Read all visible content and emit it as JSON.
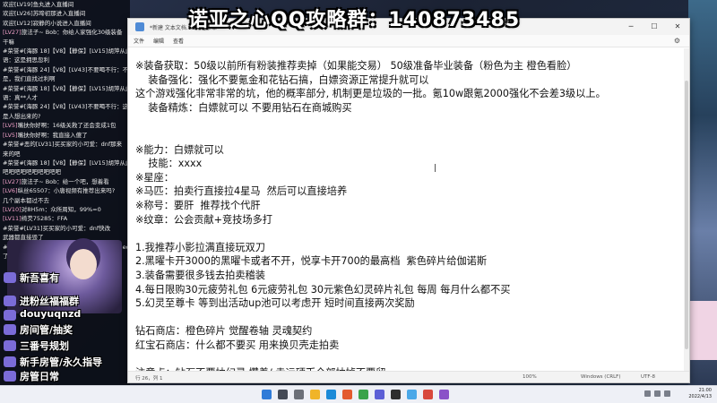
{
  "banner": "诺亚之心QQ攻略群：140873485",
  "chat": {
    "lines": [
      {
        "level": "",
        "text": "欢迎[LV19]鱼丸进入直播间"
      },
      {
        "level": "",
        "text": "欢迎[LV26]苏啼初那进入直播间"
      },
      {
        "level": "",
        "text": "欢迎[LV12]寂静的小说进入直播间"
      },
      {
        "level": "",
        "text": ""
      },
      {
        "level": "[LV27]",
        "text": "旅法子~ Bob：你给人家强化30级装备"
      },
      {
        "level": "",
        "text": "干嘛"
      },
      {
        "level": "",
        "text": "#荣誉#[海豚 18]【V8】【静保】[LV15]胡萍从此日"
      },
      {
        "level": "",
        "text": "语：这是拥思忽利"
      },
      {
        "level": "",
        "text": "#荣誉#[海豚 24]【V8】[LV43]不要喝不行：不"
      },
      {
        "level": "",
        "text": "是，我们直找过利啊"
      },
      {
        "level": "",
        "text": "#荣誉#[海豚 18]【V8】【静保】[LV15]胡萍从此日"
      },
      {
        "level": "",
        "text": "语：真**人才"
      },
      {
        "level": "",
        "text": "#荣誉#[海豚 24]【V8】[LV43]不要喝不行：这"
      },
      {
        "level": "",
        "text": "是人想出来的?"
      },
      {
        "level": "[LV5]",
        "text": "嘴扶你好啊：16级关救了还会变成1包"
      },
      {
        "level": "[LV5]",
        "text": "嘴扶你好啊：我直接入傻了"
      },
      {
        "level": "",
        "text": "#荣誉#恶的[LV31]买买家的小可爱：dnf那来"
      },
      {
        "level": "",
        "text": "来的吧"
      },
      {
        "level": "",
        "text": "#荣誉#[海豚 18]【V8】【静保】[LV15]胡萍从此日"
      },
      {
        "level": "",
        "text": "吧吧吧吧吧吧吧吧吧吧"
      },
      {
        "level": "[LV27]",
        "text": "旅法子~ Bob：给一个吧，想着看"
      },
      {
        "level": "[LV6]",
        "text": "纵丝65507：小唐视频有推荐出来吗?"
      },
      {
        "level": "",
        "text": "几个副本都过不去"
      },
      {
        "level": "[LV10]",
        "text": "对8H5m：众所周知，99%=0"
      },
      {
        "level": "[LV11]",
        "text": "绮芡75285：FFA"
      },
      {
        "level": "",
        "text": "#荣誉#[LV31]买买家的小可爱：dnf快改"
      },
      {
        "level": "",
        "text": "武器都直接毁了"
      },
      {
        "level": "",
        "text": "#荣誉#[海豚 18]【V8】[LV17]不要钱公交：ec想说愁死"
      },
      {
        "level": "",
        "text": "了"
      }
    ],
    "overlays": [
      {
        "icon": "gift-icon",
        "text": "新吾喜有"
      },
      {
        "icon": "gift-icon",
        "text": "进粉丝福福群"
      },
      {
        "icon": "douyu-icon",
        "text": "douyuqnzd"
      },
      {
        "icon": "gift-icon",
        "text": "房间管/抽奖"
      },
      {
        "icon": "gift-icon",
        "text": "三番号规划"
      },
      {
        "icon": "gift-icon",
        "text": "新手房管/永久指导"
      },
      {
        "icon": "gift-icon",
        "text": "房管日常"
      },
      {
        "icon": "gift-icon",
        "text": "兵代登播"
      }
    ]
  },
  "notepad": {
    "title": "*新建 文本文档.txt - 记事本",
    "controls": [
      "minimize-button",
      "maximize-button",
      "close-button"
    ],
    "menu": [
      "文件",
      "编辑",
      "查看"
    ],
    "lines": [
      "※装备获取：50级以前所有粉装推荐卖掉（如果能交易） 50级准备毕业装备（粉色为主 橙色看脸）",
      "    装备强化：强化不要氪金和花钻石搞，白嫖资源正常提升就可以",
      "这个游戏强化非常非常的坑，他的概率部分, 机制更是垃圾的一批。氪10w跟氪2000强化不会差3级以上。",
      "    装备精炼：白嫖就可以 不要用钻石在商城购买",
      "",
      "",
      "※能力：白嫖就可以",
      "    技能：xxxx",
      "※星座：",
      "※马匹：拍卖行直接拉4星马  然后可以直接培养",
      "※称号：要肝  推荐找个代肝",
      "※纹章：公会贡献+竞技场多打",
      "",
      "1.我推荐小影拉满直接玩双刀",
      "2.黑曜卡开3000的黑曜卡或者不开，悦享卡开700的最高档  紫色碎片给伽诺斯",
      "3.装备需要很多钱去拍卖稽装",
      "4.每日限购30元疲劳礼包 6元疲劳礼包 30元紫色幻灵碎片礼包 每周 每月什么都不买",
      "5.幻灵至尊卡 等到出活动up池可以考虑开 短时间直接两次奖励",
      "",
      "钻石商店：橙色碎片 觉醒卷轴 灵魂契约",
      "红宝石商店：什么都不要买 用来换贝壳走拍卖",
      "",
      "注意点：钻石不要抽幻灵 攒着/ 幸运硬币全部抽掉不要留"
    ],
    "status": {
      "position": "行 26，列 1",
      "zoom": "100%",
      "eol": "Windows (CRLF)",
      "encoding": "UTF-8"
    }
  },
  "taskbar": {
    "time": "21:00",
    "date": "2022/4/13"
  }
}
